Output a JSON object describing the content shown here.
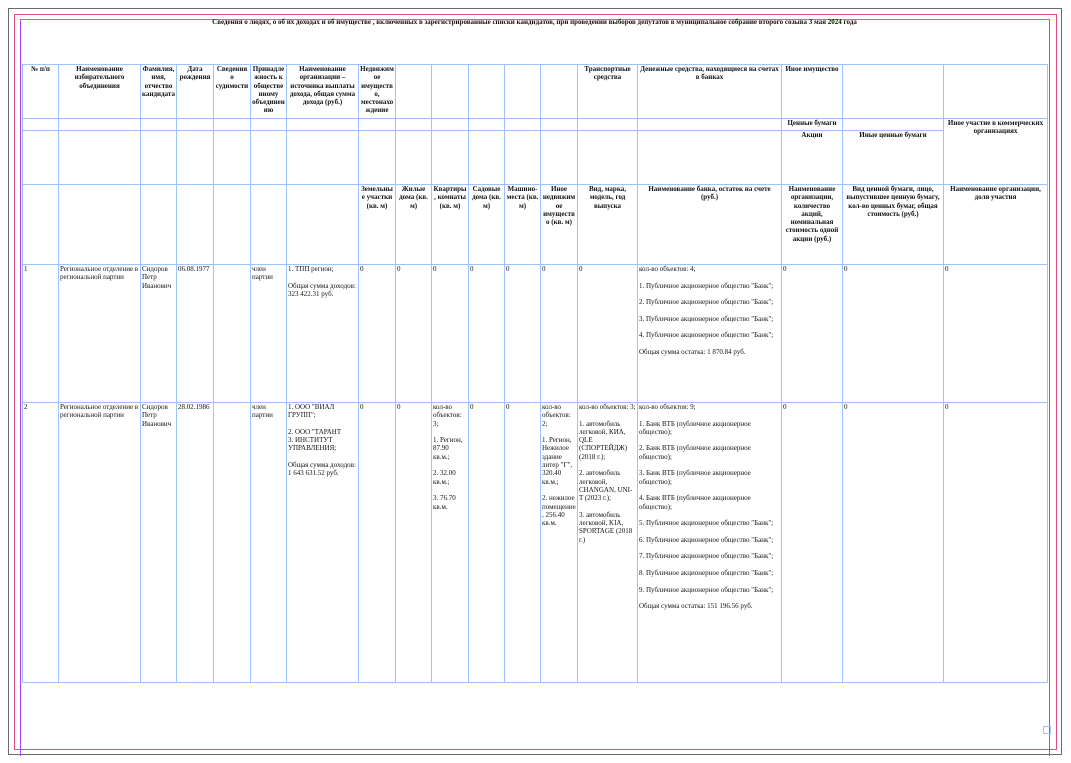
{
  "title": "Сведения о людях, о об их доходах и об имуществе , включенных в зарегистрированные списки кандидатов, при проведении выборов депутатов в муниципальное собрание второго созыва 3 мая 2024 года",
  "header": {
    "no": "№ п/п",
    "party": "Наименование избирательного объединения",
    "fio": "Фамилия, имя, отчество кандидата",
    "birth": "Дата рождения",
    "criminal": "Сведения о судимости",
    "membership": "Принадлежность к общественному объединению",
    "income": "Наименование организации – источника выплаты дохода, общая сумма дохода (руб.)",
    "realty": "Недвижимое имущество, местонахождение",
    "transport": "Транспортные средства",
    "money": "Денежные средства, находящиеся на счетах в банках",
    "other_property": "Иное имущество",
    "securities": "Ценные бумаги",
    "other_participation": "Иное участие в коммерческих организациях",
    "shares": "Акции",
    "other_securities": "Иные ценные бумаги",
    "land": "Земельные участки (кв. м)",
    "houses": "Жилые дома (кв. м)",
    "flats": "Квартиры, комнаты (кв. м)",
    "garden": "Садовые дома (кв. м)",
    "parking": "Машино-места (кв. м)",
    "other_realty": "Иное недвижимое имущество (кв. м)",
    "vehicle_kind": "Вид, марка, модель, год выпуска",
    "bank_name": "Наименование банка, остаток на счете (руб.)",
    "shares_detail": "Наименование организации, количество акций, номинальная стоимость одной акции (руб.)",
    "other_sec_detail": "Вид ценной бумаги, лицо, выпустившее ценную бумагу, кол-во ценных бумаг, общая стоимость (руб.)",
    "participation_detail": "Наименование организации, доля участия"
  },
  "rows": [
    {
      "no": "1",
      "party": "Региональное отделение в региональной партии",
      "fio": "Сидоров Петр Иванович",
      "birth": "06.08.1977",
      "criminal": "",
      "membership": "член партии",
      "income": "1. ТПП регион;\n\nОбщая сумма доходов: 323 422.31 руб.",
      "land": "0",
      "houses": "0",
      "flats": "0",
      "garden": "0",
      "parking": "0",
      "other_realty": "0",
      "transport": "0",
      "money": "кол-во объектов: 4;\n\n1. Публичное акционерное общество \"Банк\";\n\n2. Публичное акционерное общество \"Банк\";\n\n3. Публичное акционерное общество \"Банк\";\n\n4. Публичное акционерное общество \"Банк\";\n\nОбщая сумма остатка: 1 870.84 руб.",
      "shares": "0",
      "other_securities": "0",
      "participation": "0"
    },
    {
      "no": "2",
      "party": "Региональное отделение в региональной партии",
      "fio": "Сидоров Петр Иванович",
      "birth": "28.02.1986",
      "criminal": "",
      "membership": "член партии",
      "income": "1. ООО \"ВИАЛ ГРУПП\";\n\n2. ООО \"ТАРАНТ\n3. ИНСТИТУТ УПРАВЛЕНИЯ;\n\nОбщая сумма доходов: 1 643 631.52 руб.",
      "land": "0",
      "houses": "0",
      "flats": "кол-во объектов: 3;\n\n1. Регион, 87.90 кв.м.;\n\n2. 32.00 кв.м.;\n\n3. 76.70 кв.м.",
      "garden": "0",
      "parking": "0",
      "other_realty": "кол-во объектов: 2;\n\n1. Регион, Нежилое здание литер \"Г\", 320.40 кв.м.;\n\n2. нежилое помещение, 256.40 кв.м.",
      "transport": "кол-во объектов: 3;\n\n1. автомобиль легковой, КИА, QLE (СПОРТЕЙДЖ) (2018 г.);\n\n2. автомобиль легковой, CHANGAN, UNI-T (2023 г.);\n\n3. автомобиль легковой, KIA, SPORTAGE (2018 г.)",
      "money": "кол-во объектов: 9;\n\n1. Банк ВТБ (публичное акционерное общество);\n\n2. Банк ВТБ (публичное акционерное общество);\n\n3. Банк ВТБ (публичное акционерное общество);\n\n4. Банк ВТБ (публичное акционерное общество);\n\n5. Публичное акционерное общество \"Банк\";\n\n6. Публичное акционерное общество \"Банк\";\n\n7. Публичное акционерное общество \"Банк\";\n\n8. Публичное акционерное общество \"Банк\";\n\n9. Публичное акционерное общество \"Банк\";\n\nОбщая сумма остатка: 151 196.56 руб.",
      "shares": "0",
      "other_securities": "0",
      "participation": "0"
    }
  ]
}
